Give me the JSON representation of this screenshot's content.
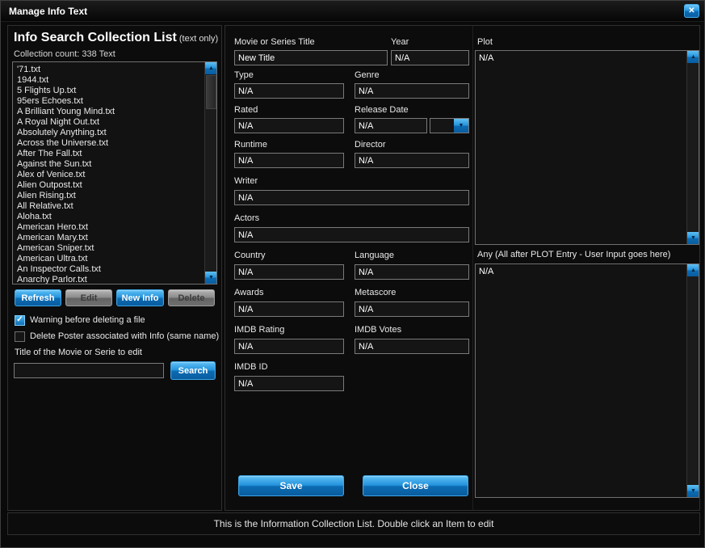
{
  "colors": {
    "accent": "#1e8fd8",
    "panel_border": "#2f2f2f"
  },
  "icons": {
    "close": "✕",
    "check": "✓",
    "arrow_up": "▲",
    "arrow_down": "▼"
  },
  "window": {
    "title": "Manage Info Text"
  },
  "left": {
    "heading": "Info Search Collection List",
    "heading_note": " (text only)",
    "count": "Collection count: 338 Text",
    "files": [
      "'71.txt",
      "1944.txt",
      "5 Flights Up.txt",
      "95ers Echoes.txt",
      "A Brilliant Young Mind.txt",
      "A Royal Night Out.txt",
      "Absolutely Anything.txt",
      "Across the Universe.txt",
      "After The Fall.txt",
      "Against the Sun.txt",
      "Alex of Venice.txt",
      "Alien Outpost.txt",
      "Alien Rising.txt",
      "All Relative.txt",
      "Aloha.txt",
      "American Hero.txt",
      "American Mary.txt",
      "American Sniper.txt",
      "American Ultra.txt",
      "An Inspector Calls.txt",
      "Anarchy Parlor.txt"
    ],
    "buttons": {
      "refresh": "Refresh",
      "edit": "Edit",
      "new_info": "New Info",
      "delete": "Delete"
    },
    "checkbox_warning": {
      "label": "Warning before deleting a file",
      "checked": true
    },
    "checkbox_poster": {
      "label": "Delete Poster associated with Info (same name)",
      "checked": false
    },
    "search_label": "Title of the Movie or Serie to edit",
    "search_value": "",
    "search_button": "Search"
  },
  "form": {
    "title": {
      "label": "Movie or Series Title",
      "value": "New Title"
    },
    "year": {
      "label": "Year",
      "value": "N/A"
    },
    "type": {
      "label": "Type",
      "value": "N/A"
    },
    "genre": {
      "label": "Genre",
      "value": "N/A"
    },
    "rated": {
      "label": "Rated",
      "value": "N/A"
    },
    "release_date": {
      "label": "Release Date",
      "value": "N/A"
    },
    "runtime": {
      "label": "Runtime",
      "value": "N/A"
    },
    "director": {
      "label": "Director",
      "value": "N/A"
    },
    "writer": {
      "label": "Writer",
      "value": "N/A"
    },
    "actors": {
      "label": "Actors",
      "value": "N/A"
    },
    "country": {
      "label": "Country",
      "value": "N/A"
    },
    "language": {
      "label": "Language",
      "value": "N/A"
    },
    "awards": {
      "label": "Awards",
      "value": "N/A"
    },
    "metascore": {
      "label": "Metascore",
      "value": "N/A"
    },
    "imdb_rating": {
      "label": "IMDB Rating",
      "value": "N/A"
    },
    "imdb_votes": {
      "label": "IMDB Votes",
      "value": "N/A"
    },
    "imdb_id": {
      "label": "IMDB ID",
      "value": "N/A"
    },
    "save_button": "Save",
    "close_button": "Close"
  },
  "plot": {
    "label": "Plot",
    "value": "N/A"
  },
  "any": {
    "label": "Any (All after PLOT Entry - User Input goes here)",
    "value": "N/A"
  },
  "status": "This is the Information Collection List. Double click an Item to edit"
}
